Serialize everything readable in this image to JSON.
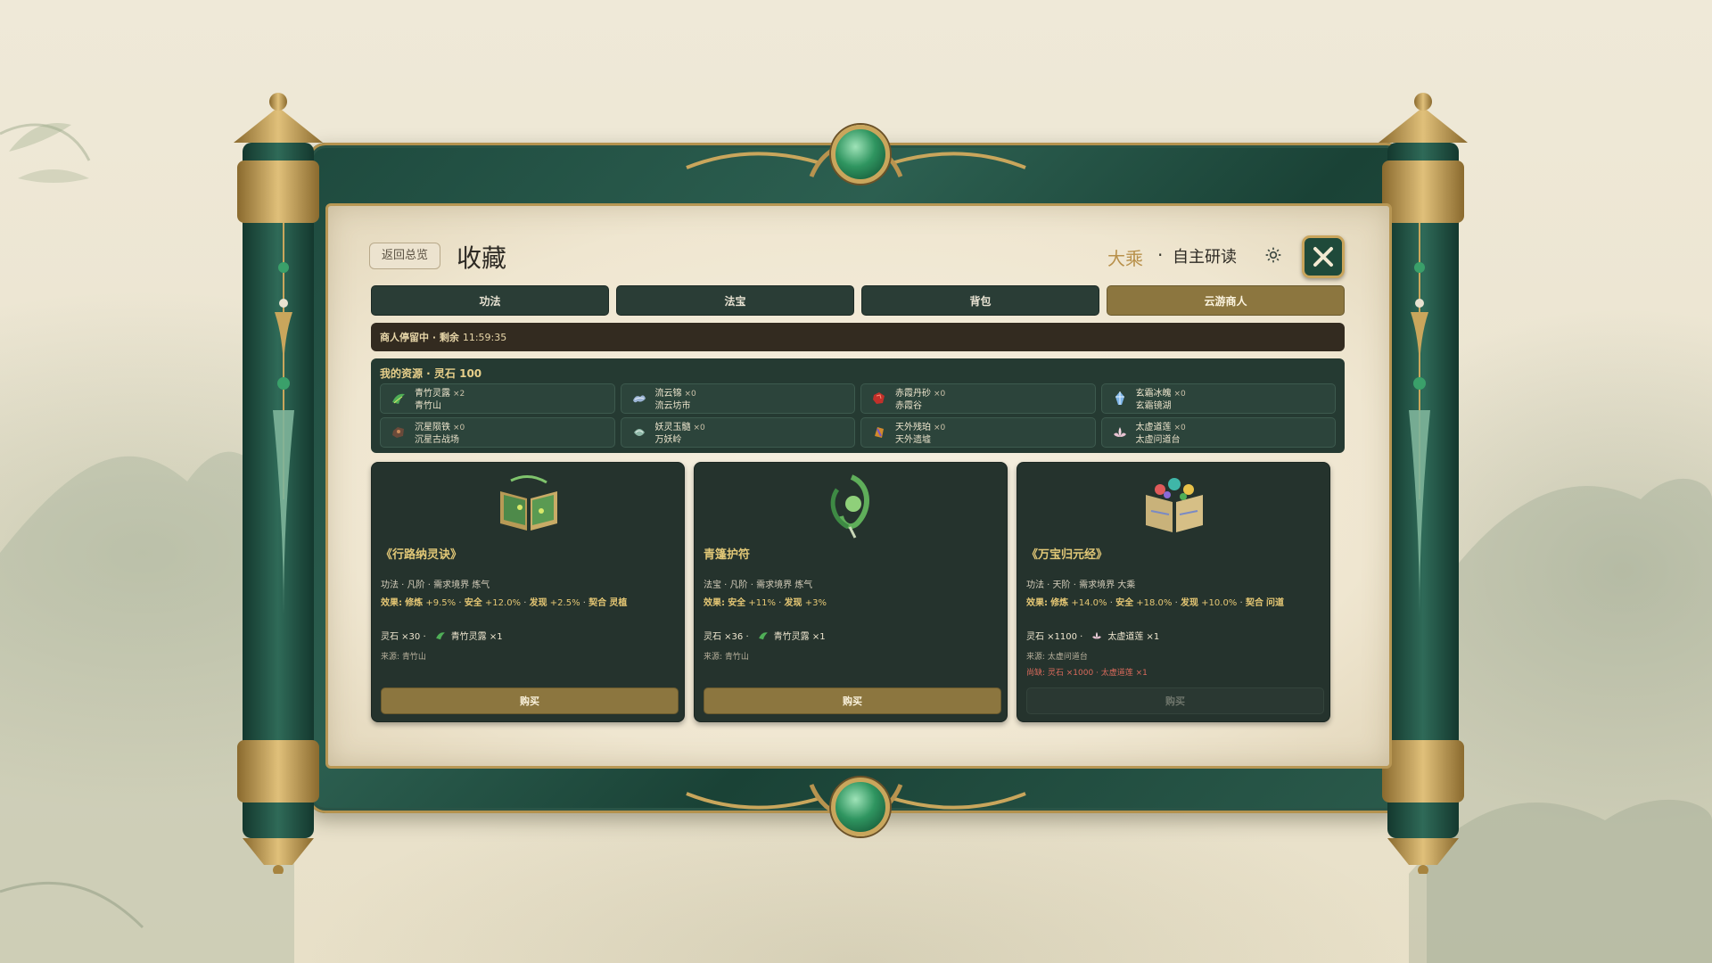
{
  "header": {
    "back_label": "返回总览",
    "title": "收藏",
    "realm": "大乘",
    "separator": "·",
    "mode": "自主研读"
  },
  "tabs": [
    {
      "label": "功法",
      "active": false
    },
    {
      "label": "法宝",
      "active": false
    },
    {
      "label": "背包",
      "active": false
    },
    {
      "label": "云游商人",
      "active": true
    }
  ],
  "merchant": {
    "status": "商人停留中 · 剩余",
    "timer": "11:59:35"
  },
  "resources": {
    "title": "我的资源 · 灵石 100",
    "items": [
      {
        "name": "青竹灵露",
        "count": "×2",
        "location": "青竹山",
        "icon": "green-dew-icon"
      },
      {
        "name": "流云锦",
        "count": "×0",
        "location": "流云坊市",
        "icon": "cloud-silk-icon"
      },
      {
        "name": "赤霞丹砂",
        "count": "×0",
        "location": "赤霞谷",
        "icon": "red-cinnabar-icon"
      },
      {
        "name": "玄霜冰魄",
        "count": "×0",
        "location": "玄霜镜湖",
        "icon": "ice-crystal-icon"
      },
      {
        "name": "沉星陨铁",
        "count": "×0",
        "location": "沉星古战场",
        "icon": "meteor-iron-icon"
      },
      {
        "name": "妖灵玉髓",
        "count": "×0",
        "location": "万妖岭",
        "icon": "spirit-jade-icon"
      },
      {
        "name": "天外残珀",
        "count": "×0",
        "location": "天外遗墟",
        "icon": "amber-icon"
      },
      {
        "name": "太虚道莲",
        "count": "×0",
        "location": "太虚问道台",
        "icon": "lotus-icon"
      }
    ]
  },
  "cards": [
    {
      "name": "《行路纳灵诀》",
      "meta": "功法 · 凡阶 · 需求境界 炼气",
      "effect_label": "效果:",
      "effects": [
        {
          "k": "修炼",
          "v": "+9.5%"
        },
        {
          "k": "安全",
          "v": "+12.0%"
        },
        {
          "k": "发现",
          "v": "+2.5%"
        },
        {
          "k": "契合",
          "v": "灵植"
        }
      ],
      "cost_stone": "灵石 ×30 ·",
      "cost_item": "青竹灵露 ×1",
      "source": "来源: 青竹山",
      "lack": "",
      "buy_label": "购买",
      "buy_enabled": true,
      "art": "spell-book-icon",
      "mini_icon": "green-dew-icon"
    },
    {
      "name": "青篷护符",
      "meta": "法宝 · 凡阶 · 需求境界 炼气",
      "effect_label": "效果:",
      "effects": [
        {
          "k": "安全",
          "v": "+11%"
        },
        {
          "k": "发现",
          "v": "+3%"
        }
      ],
      "cost_stone": "灵石 ×36 ·",
      "cost_item": "青竹灵露 ×1",
      "source": "来源: 青竹山",
      "lack": "",
      "buy_label": "购买",
      "buy_enabled": true,
      "art": "jade-talisman-icon",
      "mini_icon": "green-dew-icon"
    },
    {
      "name": "《万宝归元经》",
      "meta": "功法 · 天阶 · 需求境界 大乘",
      "effect_label": "效果:",
      "effects": [
        {
          "k": "修炼",
          "v": "+14.0%"
        },
        {
          "k": "安全",
          "v": "+18.0%"
        },
        {
          "k": "发现",
          "v": "+10.0%"
        },
        {
          "k": "契合",
          "v": "问道"
        }
      ],
      "cost_stone": "灵石 ×1100 ·",
      "cost_item": "太虚道莲 ×1",
      "source": "来源: 太虚问道台",
      "lack": "尚缺: 灵石 ×1000 · 太虚道莲 ×1",
      "buy_label": "购买",
      "buy_enabled": false,
      "art": "treasure-book-icon",
      "mini_icon": "lotus-icon"
    }
  ],
  "colors": {
    "gold": "#b8904a",
    "frame_green": "#1e4a3e",
    "tab_active": "#8c763f",
    "panel_dark": "#25332d"
  }
}
